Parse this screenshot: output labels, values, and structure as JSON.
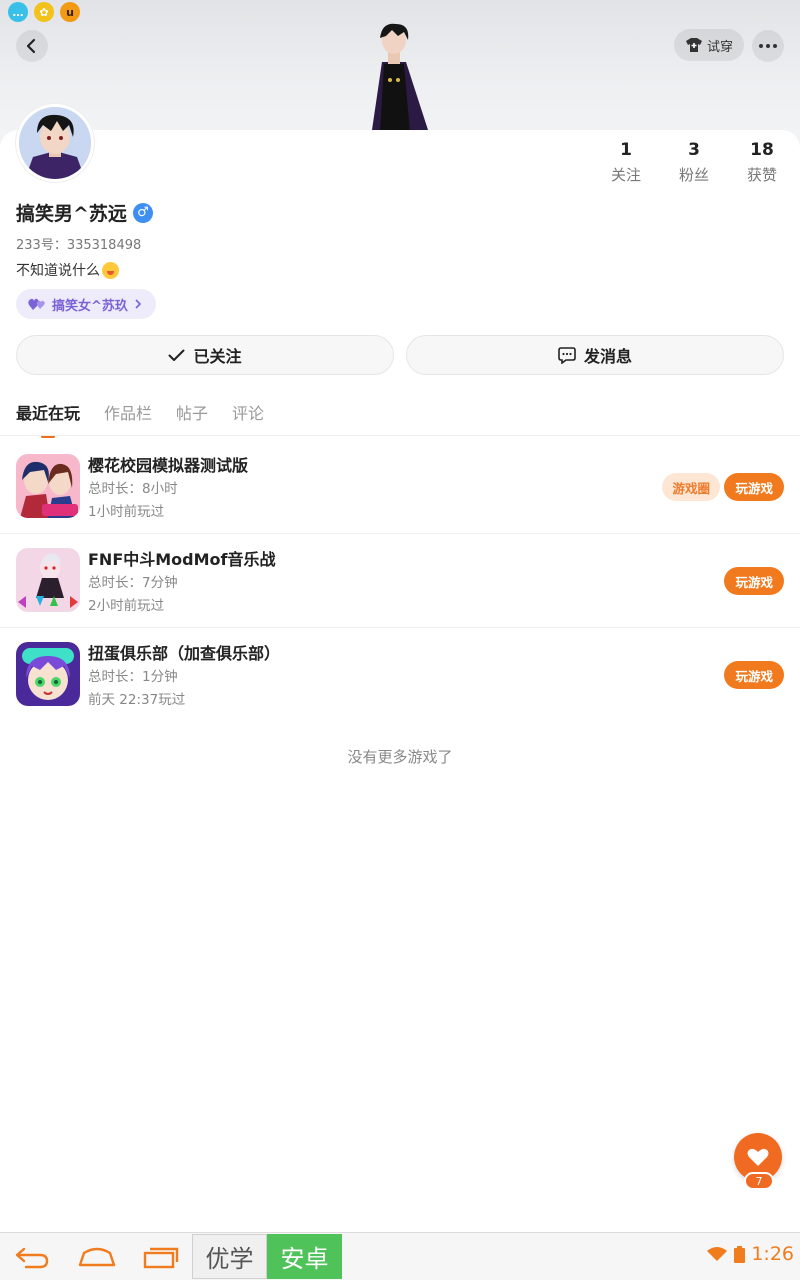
{
  "status_icons": [
    "chat-bubble-icon",
    "gear-badge-icon",
    "u-badge-icon"
  ],
  "header": {
    "tryon_label": "试穿"
  },
  "profile": {
    "name": "搞笑男^苏远",
    "gender_symbol": "♂",
    "uid": "233号：335318498",
    "bio": "不知道说什么",
    "cp_tag": "搞笑女^苏玖"
  },
  "stats": {
    "following": {
      "num": "1",
      "label": "关注"
    },
    "fans": {
      "num": "3",
      "label": "粉丝"
    },
    "likes": {
      "num": "18",
      "label": "获赞"
    }
  },
  "actions": {
    "follow_label": "已关注",
    "message_label": "发消息"
  },
  "tabs": [
    {
      "label": "最近在玩",
      "active": true
    },
    {
      "label": "作品栏",
      "active": false
    },
    {
      "label": "帖子",
      "active": false
    },
    {
      "label": "评论",
      "active": false
    }
  ],
  "games": [
    {
      "title": "樱花校园模拟器测试版",
      "duration": "总时长：8小时",
      "last_played": "1小时前玩过",
      "circle_label": "游戏圈",
      "play_label": "玩游戏"
    },
    {
      "title": "FNF中斗ModMof音乐战",
      "duration": "总时长：7分钟",
      "last_played": "2小时前玩过",
      "play_label": "玩游戏"
    },
    {
      "title": "扭蛋俱乐部（加查俱乐部）",
      "duration": "总时长：1分钟",
      "last_played": "前天 22:37玩过",
      "play_label": "玩游戏"
    }
  ],
  "no_more": "没有更多游戏了",
  "fab": {
    "count": "7"
  },
  "system_bar": {
    "ime_left": "优学",
    "ime_right": "安卓",
    "time": "1:26"
  },
  "colors": {
    "accent": "#f06d1a",
    "cp_tag_bg": "#eeebfb",
    "cp_tag_fg": "#7b63d6",
    "gender_blue": "#3f8ff0",
    "ime_green": "#4fc25a"
  }
}
